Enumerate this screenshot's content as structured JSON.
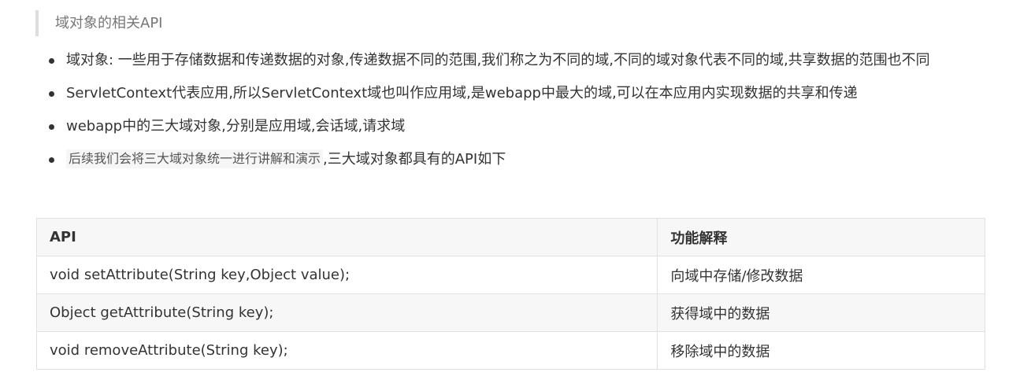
{
  "heading": "域对象的相关API",
  "bullets": [
    {
      "text": "域对象: 一些用于存储数据和传递数据的对象,传递数据不同的范围,我们称之为不同的域,不同的域对象代表不同的域,共享数据的范围也不同"
    },
    {
      "text": "ServletContext代表应用,所以ServletContext域也叫作应用域,是webapp中最大的域,可以在本应用内实现数据的共享和传递"
    },
    {
      "text": "webapp中的三大域对象,分别是应用域,会话域,请求域"
    },
    {
      "code": "后续我们会将三大域对象统一进行讲解和演示",
      "text": ",三大域对象都具有的API如下"
    }
  ],
  "table": {
    "headers": [
      "API",
      "功能解释"
    ],
    "rows": [
      [
        "void setAttribute(String key,Object value);",
        "向域中存储/修改数据"
      ],
      [
        "Object getAttribute(String key);",
        "获得域中的数据"
      ],
      [
        "void removeAttribute(String key);",
        "移除域中的数据"
      ]
    ]
  }
}
